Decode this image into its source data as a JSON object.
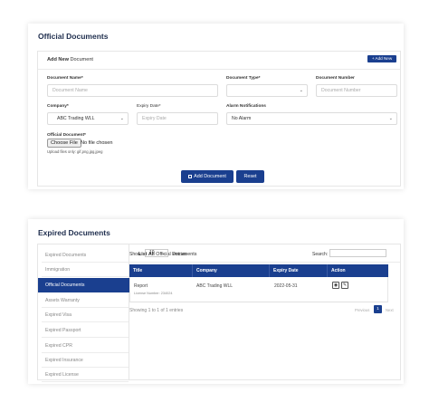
{
  "official": {
    "title": "Official Documents",
    "add_header_bold": "Add New",
    "add_header_rest": " Document",
    "add_new_button": "+ Add New",
    "fields": {
      "document_name": {
        "label": "Document Name*",
        "placeholder": "Document Name"
      },
      "document_type": {
        "label": "Document Type*",
        "value": ""
      },
      "document_number": {
        "label": "Document Number",
        "placeholder": "Document Number"
      },
      "company": {
        "label": "Company*",
        "value": "ABC Trading WLL"
      },
      "expiry_date": {
        "label": "Expiry Date*",
        "placeholder": "Expiry Date"
      },
      "alarm": {
        "label": "Alarm Notifications",
        "value": "No Alarm"
      },
      "official_document": {
        "label": "Official Document*",
        "button": "Choose File",
        "status": "No file chosen",
        "hint": "Upload files only: gif,png,jpg,jpeg"
      }
    },
    "add_document_button": "Add Document",
    "reset_button": "Reset"
  },
  "expired": {
    "title": "Expired Documents",
    "sidebar": [
      {
        "label": "Expired Documents"
      },
      {
        "label": "Immigration"
      },
      {
        "label": "Official Documents"
      },
      {
        "label": "Assets Warranty"
      },
      {
        "label": "Expired Visa"
      },
      {
        "label": "Expired Passport"
      },
      {
        "label": "Expired CPR"
      },
      {
        "label": "Expired Insurance"
      },
      {
        "label": "Expired License"
      }
    ],
    "active_item": "Official Documents",
    "list_header_bold": "List All",
    "list_header_rest": " Official Documents",
    "show_label": "Show",
    "entries_value": "10",
    "entries_label": "entries",
    "search_label": "Search:",
    "columns": [
      "Title",
      "Company",
      "Expiry Date",
      "Action"
    ],
    "rows": [
      {
        "title": "Report",
        "license": "License Number: 234024",
        "company": "ABC Trading WLL",
        "expiry": "2022-05-31"
      }
    ],
    "showing": "Showing 1 to 1 of 1 entries",
    "pagination": {
      "previous": "Previous",
      "page": "1",
      "next": "Next"
    }
  },
  "colors": {
    "primary": "#1a3f8f"
  },
  "icons": [
    "view-icon",
    "edit-icon",
    "chevron-down-icon",
    "save-icon"
  ]
}
